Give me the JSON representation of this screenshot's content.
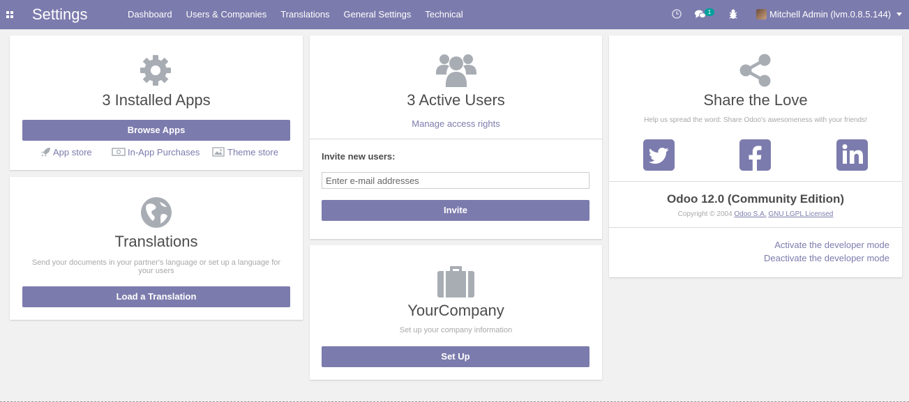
{
  "app": {
    "title": "Settings"
  },
  "menu": [
    {
      "label": "Dashboard"
    },
    {
      "label": "Users & Companies"
    },
    {
      "label": "Translations"
    },
    {
      "label": "General Settings"
    },
    {
      "label": "Technical"
    }
  ],
  "systray": {
    "clock_icon": "clock-icon",
    "messages_icon": "messages-icon",
    "messages_count": "1",
    "debug_icon": "bug-icon",
    "user_label": "Mitchell Admin (lvm.0.8.5.144)"
  },
  "apps_card": {
    "icon": "gear-icon",
    "title": "3 Installed Apps",
    "button": "Browse Apps",
    "links": [
      {
        "icon": "rocket-icon",
        "label": "App store"
      },
      {
        "icon": "money-icon",
        "label": "In-App Purchases"
      },
      {
        "icon": "picture-icon",
        "label": "Theme store"
      }
    ]
  },
  "translations_card": {
    "icon": "globe-icon",
    "title": "Translations",
    "subtitle": "Send your documents in your partner's language or set up a language for your users",
    "button": "Load a Translation"
  },
  "users_card": {
    "icon": "users-icon",
    "title": "3 Active Users",
    "manage_link": "Manage access rights",
    "invite_label": "Invite new users:",
    "email_placeholder": "Enter e-mail addresses",
    "email_value": "",
    "invite_button": "Invite"
  },
  "company_card": {
    "icon": "briefcase-icon",
    "title": "YourCompany",
    "subtitle": "Set up your company information",
    "button": "Set Up"
  },
  "share_card": {
    "icon": "share-icon",
    "title": "Share the Love",
    "subtitle": "Help us spread the word: Share Odoo's awesomeness with your friends!",
    "socials": [
      {
        "icon": "twitter-icon"
      },
      {
        "icon": "facebook-icon"
      },
      {
        "icon": "linkedin-icon"
      }
    ],
    "edition": "Odoo 12.0 (Community Edition)",
    "copyright_prefix": "Copyright © 2004",
    "company_link": "Odoo S.A.",
    "license_link": "GNU LGPL Licensed",
    "dev_activate": "Activate the developer mode",
    "dev_deactivate": "Deactivate the developer mode"
  },
  "colors": {
    "brand": "#7c7bad",
    "background": "#f1f1f1",
    "icon_gray": "#a8adb4",
    "badge": "#00a09d"
  }
}
